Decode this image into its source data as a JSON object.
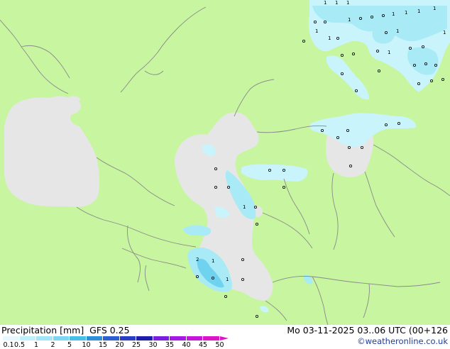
{
  "footer": {
    "title_left": "Precipitation [mm]  GFS 0.25",
    "title_right": "Mo 03-11-2025 03..06 UTC (00+126",
    "credit": "©weatheronline.co.uk"
  },
  "legend": {
    "ticks": [
      "0.1",
      "0.5",
      "1",
      "2",
      "5",
      "10",
      "15",
      "20",
      "25",
      "30",
      "35",
      "40",
      "45",
      "50"
    ],
    "colors": [
      "#e8f8ff",
      "#bff0fb",
      "#a0e6f8",
      "#7cd7f3",
      "#49bfe8",
      "#2f8ed9",
      "#2d5fcf",
      "#2b3dc3",
      "#1f1eaa",
      "#7a1fe0",
      "#a519e6",
      "#c617d9",
      "#de15c6"
    ]
  },
  "map_colors": {
    "land": "#c8f5a0",
    "water": "#e6e6e6",
    "border": "#8a8a8a",
    "precip_light": "#c9f4fb",
    "precip_mid": "#a8eaf6",
    "precip_heavy": "#6fd3ef"
  },
  "map_values": [
    "1",
    "1",
    "1",
    "1",
    "1",
    "1",
    "1",
    "1",
    "1",
    "1",
    "1",
    "2",
    "1",
    "1",
    "1",
    "1",
    "1"
  ]
}
